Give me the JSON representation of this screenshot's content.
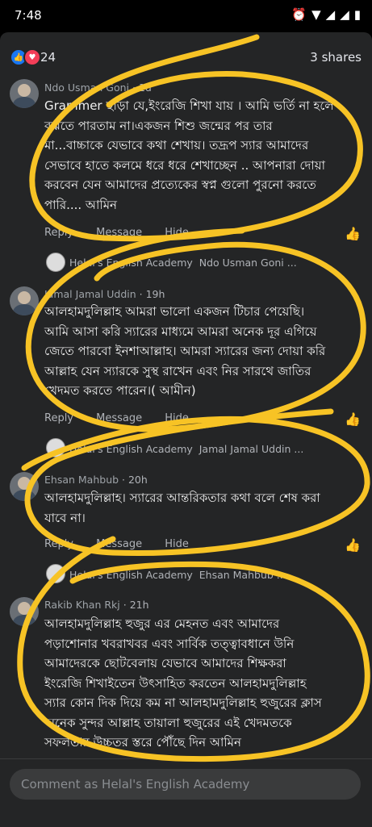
{
  "status_bar": {
    "time": "7:48",
    "icons": [
      "alarm-icon",
      "wifi-icon",
      "signal-icon",
      "signal-icon",
      "battery-icon"
    ]
  },
  "reactions": {
    "count": "24",
    "shares": "3 shares"
  },
  "comments": [
    {
      "author": "Ndo Usman Goni",
      "time": "1d",
      "lines": [
        "Grammer ছাড়া যে,ইংরেজি শিখা যায় । আমি ভর্তি না হলে",
        "বুঝতে পারতাম না।একজন শিশু জন্মের পর তার",
        "মা...বাচ্চাকে যেভাবে কথা শেখায়। তদ্রূপ স্যার আমাদের",
        "সেভাবে হাতে কলমে ধরে ধরে শেখাচ্ছেন .. আপনারা দোয়া",
        "করবেন যেন আমাদের প্রত্যেকের স্বপ্ন গুলো পুরনো করতে",
        "পারি.... আমিন"
      ],
      "actions": {
        "reply": "Reply",
        "message": "Message",
        "hide": "Hide"
      },
      "reply_page": "Helal's English Academy",
      "reply_to": "Ndo Usman Goni ..."
    },
    {
      "author": "Jamal Jamal Uddin",
      "time": "19h",
      "lines": [
        "আলহামদুলিল্লাহ আমরা ভালো একজন টিচার পেয়েছি।",
        "আমি আসা করি স্যারের মাধ্যমে আমরা অনেক দূর এগিয়ে",
        "জেতে পারবো ইনশাআল্লাহ। আমরা স্যারের জন্য দোয়া করি",
        "আল্লাহ যেন স্যারকে সুস্থ রাখেন এবং নির সারথে জাতির",
        "খেদমত করতে পারেন।( আমীন)"
      ],
      "actions": {
        "reply": "Reply",
        "message": "Message",
        "hide": "Hide"
      },
      "reply_page": "Helal's English Academy",
      "reply_to": "Jamal Jamal Uddin ..."
    },
    {
      "author": "Ehsan Mahbub",
      "time": "20h",
      "lines": [
        "আলহামদুলিল্লাহ। স্যারের আন্তরিকতার কথা বলে শেষ করা",
        "যাবে না।"
      ],
      "actions": {
        "reply": "Reply",
        "message": "Message",
        "hide": "Hide"
      },
      "reply_page": "Helal's English Academy",
      "reply_to": "Ehsan Mahbub ..."
    },
    {
      "author": "Rakib Khan Rkj",
      "time": "21h",
      "lines": [
        "আলহামদুলিল্লাহ হুজুর এর মেহনত এবং আমাদের",
        "পড়াশোনার খবরাখবর এবং সার্বিক তত্ত্বাবধানে উনি",
        "আমাদেরকে ছোটবেলায় যেভাবে আমাদের শিক্ষকরা",
        "ইংরেজি শিখাইতেন উৎসাহিত করতেন আলহামদুলিল্লাহ",
        "স্যার কোন দিক দিয়ে কম না আলহামদুলিল্লাহ হুজুরের ক্লাস",
        "অনেক সুন্দর আল্লাহ তায়ালা হুজুরের এই খেদমতকে",
        "সফলতার উচ্চতর স্তরে পৌঁছে দিন আমিন"
      ]
    }
  ],
  "composer": {
    "placeholder": "Comment as Helal's English Academy"
  },
  "colors": {
    "accent": "#2d88ff",
    "annotation": "#f7c325",
    "panel": "#242526"
  }
}
